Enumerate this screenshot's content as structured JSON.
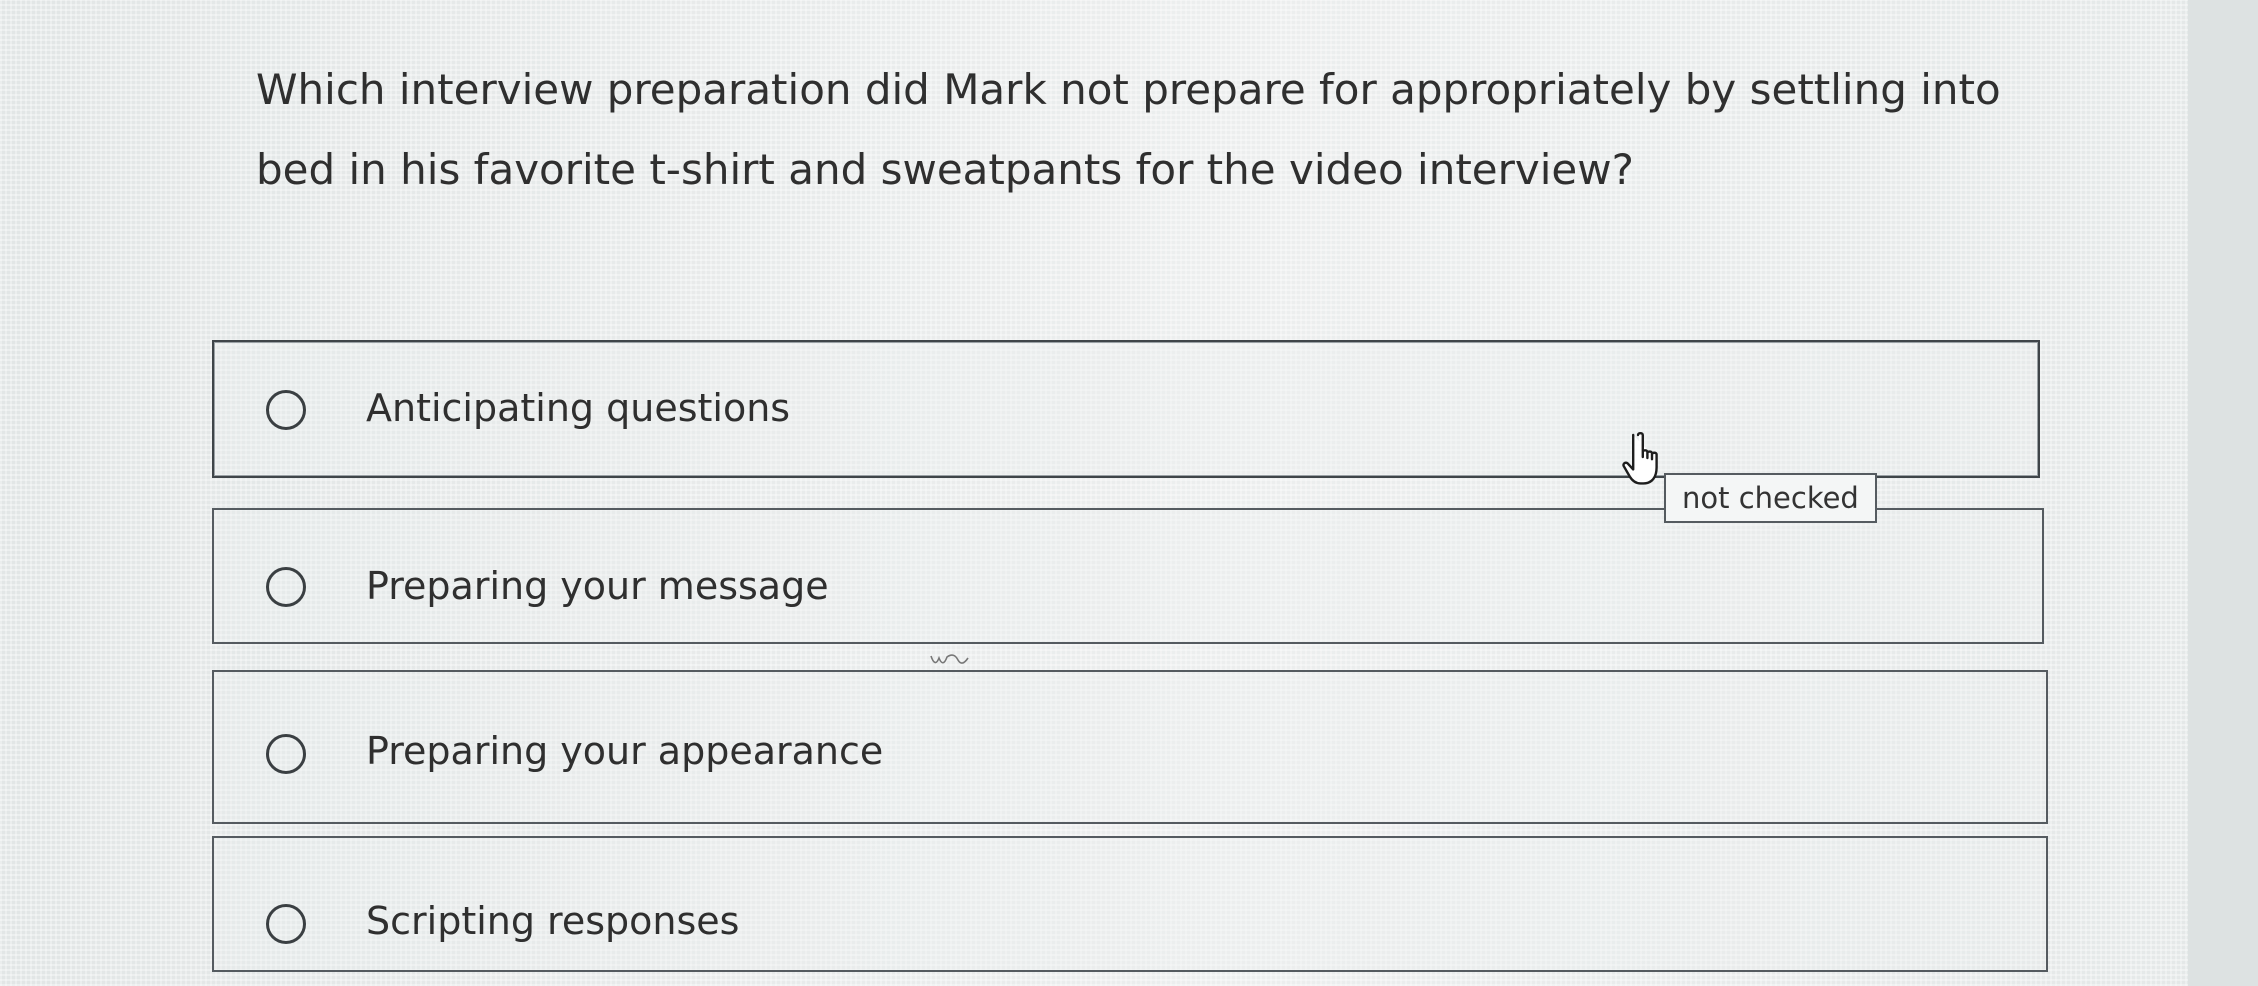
{
  "question": {
    "text": "Which interview preparation did Mark not prepare for appropriately by settling into bed in his favorite t-shirt and sweatpants for the video interview?"
  },
  "options": [
    {
      "label": "Anticipating questions",
      "selected": false
    },
    {
      "label": "Preparing your message",
      "selected": false
    },
    {
      "label": "Preparing your appearance",
      "selected": false
    },
    {
      "label": "Scripting responses",
      "selected": false
    }
  ],
  "tooltip": {
    "text": "not checked"
  },
  "icons": {
    "cursor": "hand-pointer-icon",
    "radio": "radio-unchecked-icon"
  },
  "colors": {
    "border": "#555b60",
    "text": "#2f2f2f",
    "background": "#e9ecec"
  }
}
